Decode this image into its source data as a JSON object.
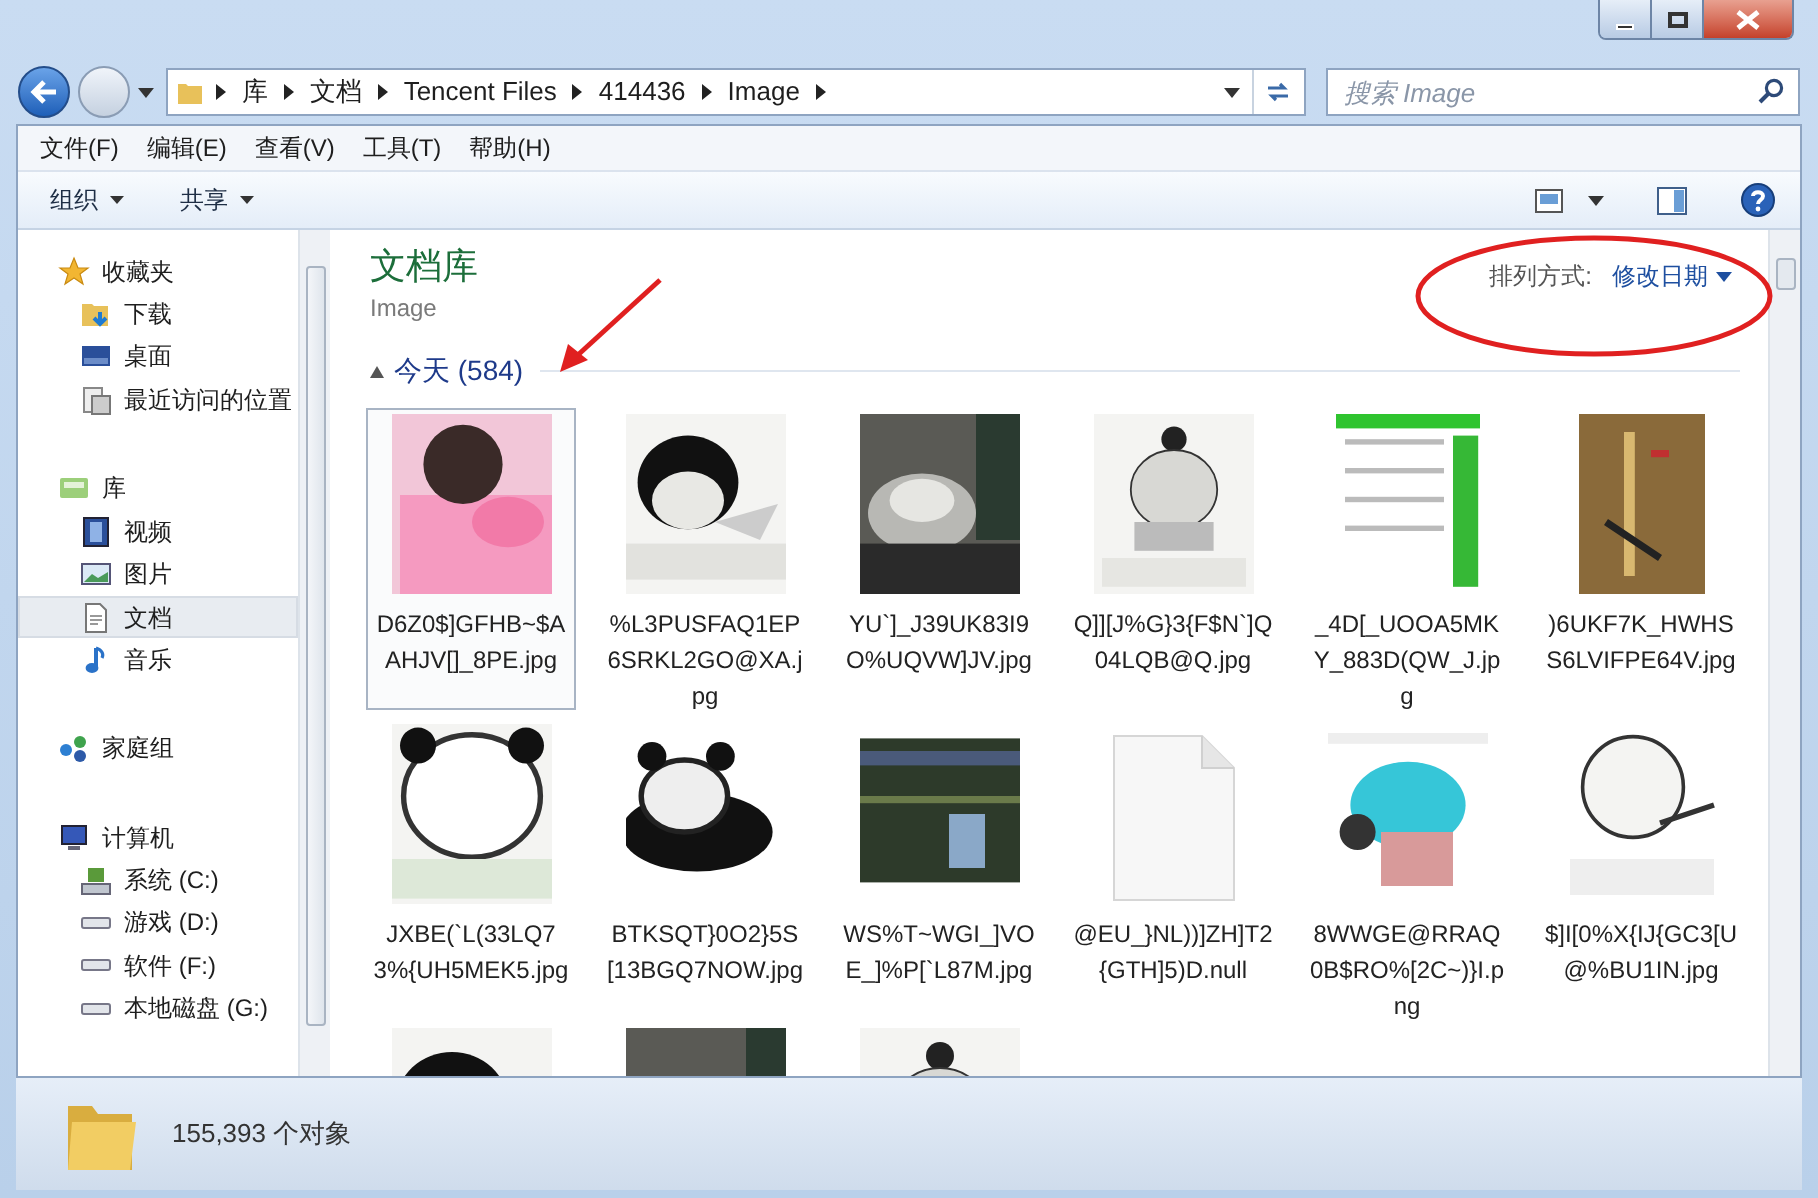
{
  "address_bar": {
    "crumbs": [
      "库",
      "文档",
      "Tencent Files",
      "414436",
      "Image"
    ]
  },
  "search": {
    "placeholder": "搜索 Image"
  },
  "menu": [
    "文件(F)",
    "编辑(E)",
    "查看(V)",
    "工具(T)",
    "帮助(H)"
  ],
  "toolbar": {
    "buttons": [
      "组织",
      "共享"
    ]
  },
  "sidebar": {
    "groups": [
      {
        "label": "收藏夹",
        "items": [
          {
            "label": "下载",
            "selected": false
          },
          {
            "label": "桌面",
            "selected": false
          },
          {
            "label": "最近访问的位置",
            "selected": false
          }
        ]
      },
      {
        "label": "库",
        "items": [
          {
            "label": "视频",
            "selected": false
          },
          {
            "label": "图片",
            "selected": false
          },
          {
            "label": "文档",
            "selected": true
          },
          {
            "label": "音乐",
            "selected": false
          }
        ]
      },
      {
        "label": "家庭组"
      },
      {
        "label": "计算机",
        "items": [
          {
            "label": "系统 (C:)",
            "selected": false
          },
          {
            "label": "游戏 (D:)",
            "selected": false
          },
          {
            "label": "软件 (F:)",
            "selected": false
          },
          {
            "label": "本地磁盘 (G:)",
            "selected": false
          }
        ]
      }
    ]
  },
  "library": {
    "title": "文档库",
    "subtitle": "Image",
    "arrange_label": "排列方式:",
    "arrange_value": "修改日期"
  },
  "group": {
    "label": "今天 (584)",
    "expanded": true
  },
  "files": [
    {
      "name": "D6Z0$]GFHB~$AAHJV[]_8PE.jpg",
      "selected": true
    },
    {
      "name": "%L3PUSFAQ1EP6SRKL2GO@XA.jpg",
      "selected": false
    },
    {
      "name": "YU`]_J39UK83I9O%UQVW]JV.jpg",
      "selected": false
    },
    {
      "name": "Q]][J%G}3{F$N`]Q04LQB@Q.jpg",
      "selected": false
    },
    {
      "name": "_4D[_UOOA5MKY_883D(QW_J.jpg",
      "selected": false
    },
    {
      "name": ")6UKF7K_HWHSS6LVIFPE64V.jpg",
      "selected": false
    },
    {
      "name": "JXBE(`L(33LQ73%{UH5MEK5.jpg",
      "selected": false
    },
    {
      "name": "BTKSQT}0O2}5S[13BGQ7NOW.jpg",
      "selected": false
    },
    {
      "name": "WS%T~WGI_]VOE_]%P[`L87M.jpg",
      "selected": false
    },
    {
      "kind": "file",
      "name": "@EU_}NL))]ZH]T2{GTH]5)D.null",
      "selected": false
    },
    {
      "name": "8WWGE@RRAQ0B$RO%[2C~)}I.png",
      "selected": false
    },
    {
      "name": "$]I[0%X{IJ{GC3[U@%BU1IN.jpg",
      "selected": false
    }
  ],
  "status_bar": {
    "count": "155,393 个对象"
  }
}
